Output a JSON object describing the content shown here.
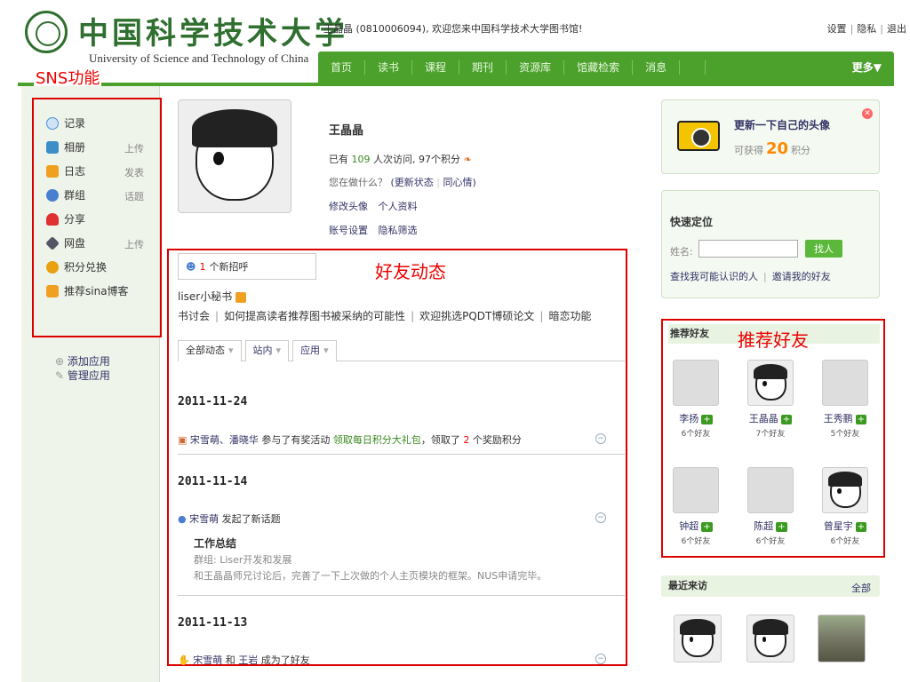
{
  "header": {
    "logo_cn": "中国科学技术大学",
    "logo_en": "University of Science and Technology of China",
    "welcome": "王晶晶 (0810006094), 欢迎您来中国科学技术大学图书馆!",
    "links": [
      "设置",
      "隐私",
      "退出"
    ]
  },
  "nav": {
    "items": [
      "首页",
      "读书",
      "课程",
      "期刊",
      "资源库",
      "馆藏检索",
      "消息",
      ""
    ],
    "more": "更多▼"
  },
  "annotations": {
    "sns": "SNS功能",
    "feed": "好友动态",
    "recommend": "推荐好友"
  },
  "sidebar": {
    "items": [
      {
        "label": "记录",
        "action": "",
        "icon": "chat-bubble-icon",
        "color": "#4a90d9"
      },
      {
        "label": "相册",
        "action": "上传",
        "icon": "photo-album-icon",
        "color": "#3b8ec8"
      },
      {
        "label": "日志",
        "action": "发表",
        "icon": "journal-icon",
        "color": "#f0a020"
      },
      {
        "label": "群组",
        "action": "话题",
        "icon": "group-icon",
        "color": "#4a7fd0"
      },
      {
        "label": "分享",
        "action": "",
        "icon": "heart-share-icon",
        "color": "#e03030"
      },
      {
        "label": "网盘",
        "action": "上传",
        "icon": "disk-icon",
        "color": "#556"
      },
      {
        "label": "积分兑换",
        "action": "",
        "icon": "coins-icon",
        "color": "#e8a010"
      },
      {
        "label": "推荐sina博客",
        "action": "",
        "icon": "blog-icon",
        "color": "#f0a020"
      }
    ],
    "apps": [
      "添加应用",
      "管理应用"
    ]
  },
  "profile": {
    "name": "王晶晶",
    "visits_prefix": "已有",
    "visits": "109",
    "visits_suffix": "人次访问, 97个积分",
    "status_q": "您在做什么？",
    "status_update": "(更新状态",
    "status_sympathy": "同心情)",
    "links1": "修改头像 个人资料",
    "links2": "账号设置 隐私筛选"
  },
  "feed": {
    "greet_count": "1",
    "greet_text": "个新招呼",
    "liser": "liser小秘书",
    "ticker": [
      "书讨会",
      "如何提高读者推荐图书被采纳的可能性",
      "欢迎挑选PQDT博硕论文",
      "暗恋功能"
    ],
    "tabs": [
      "全部动态",
      "站内",
      "应用"
    ],
    "groups": [
      {
        "date": "2011-11-24",
        "actors": "宋雪萌、潘晓华",
        "verb": "参与了有奖活动",
        "activity": "领取每日积分大礼包",
        "tail_a": "，领取了",
        "num": "2",
        "tail_b": "个奖励积分"
      },
      {
        "date": "2011-11-14",
        "actor": "宋雪萌",
        "verb": "发起了新话题",
        "topic": "工作总结",
        "group_label": "群组: ",
        "group_name": "Liser开发和发展",
        "desc": "和王晶晶师兄讨论后，完善了一下上次做的个人主页模块的框架。NUS申请完毕。"
      },
      {
        "date": "2011-11-13",
        "actor_a": "宋雪萌",
        "mid": "和",
        "actor_b": "王岩",
        "verb": "成为了好友"
      }
    ]
  },
  "right": {
    "avatar_title": "更新一下自己的头像",
    "avatar_sub_a": "可获得",
    "avatar_points": "20",
    "avatar_sub_b": "积分",
    "locate_title": "快速定位",
    "name_label": "姓名:",
    "name_value": "",
    "find_btn": "找人",
    "locate_links": [
      "查找我可能认识的人",
      "邀请我的好友"
    ],
    "rec_head": "推荐好友",
    "friends": [
      {
        "name": "李扬",
        "count": "6个好友"
      },
      {
        "name": "王晶晶",
        "count": "7个好友"
      },
      {
        "name": "王秀鹏",
        "count": "5个好友"
      },
      {
        "name": "钟超",
        "count": "6个好友"
      },
      {
        "name": "陈超",
        "count": "6个好友"
      },
      {
        "name": "曾星宇",
        "count": "6个好友"
      }
    ],
    "visitors_head": "最近来访",
    "visitors_all": "全部"
  },
  "colors": {
    "brand_green": "#4ca12d",
    "annotation_red": "#e00000",
    "link": "#333366"
  }
}
